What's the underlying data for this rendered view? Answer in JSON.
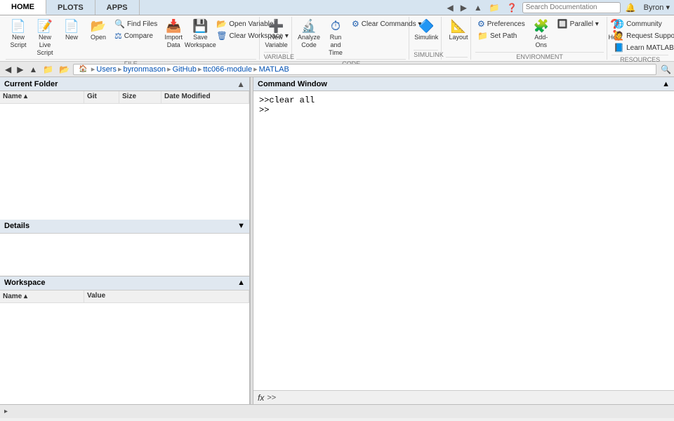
{
  "tabs": [
    {
      "label": "HOME",
      "active": true
    },
    {
      "label": "PLOTS",
      "active": false
    },
    {
      "label": "APPS",
      "active": false
    }
  ],
  "search": {
    "placeholder": "Search Documentation"
  },
  "user": {
    "label": "Byron ▾"
  },
  "ribbon": {
    "sections": [
      {
        "label": "FILE",
        "items": [
          {
            "type": "big",
            "icon": "📄",
            "label": "New\nScript"
          },
          {
            "type": "big",
            "icon": "📝",
            "label": "New\nLive Script"
          },
          {
            "type": "big",
            "icon": "📄",
            "label": "New"
          },
          {
            "type": "big",
            "icon": "📂",
            "label": "Open"
          },
          {
            "type": "small-group",
            "items": [
              {
                "icon": "🔍",
                "label": "Find Files"
              },
              {
                "icon": "⚖",
                "label": "Compare"
              }
            ]
          },
          {
            "type": "big",
            "icon": "📥",
            "label": "Import\nData"
          },
          {
            "type": "big",
            "icon": "💾",
            "label": "Save\nWorkspace"
          },
          {
            "type": "small-group",
            "items": [
              {
                "icon": "📂",
                "label": "Open Variable"
              },
              {
                "icon": "🗑",
                "label": "Clear Workspace ▾"
              }
            ]
          }
        ]
      },
      {
        "label": "VARIABLE",
        "items": [
          {
            "type": "big",
            "icon": "➕",
            "label": "New\nVariable"
          }
        ]
      },
      {
        "label": "CODE",
        "items": [
          {
            "type": "big",
            "icon": "▶",
            "label": "Analyze\nCode"
          },
          {
            "type": "big",
            "icon": "▶▶",
            "label": "Run and\nTime"
          },
          {
            "type": "small-group",
            "items": [
              {
                "icon": "⚙",
                "label": "Clear Commands ▾"
              }
            ]
          }
        ]
      },
      {
        "label": "SIMULINK",
        "items": [
          {
            "type": "big",
            "icon": "🔷",
            "label": "Simulink"
          }
        ]
      },
      {
        "label": "",
        "items": [
          {
            "type": "big",
            "icon": "📐",
            "label": "Layout"
          }
        ]
      },
      {
        "label": "ENVIRONMENT",
        "items": [
          {
            "type": "small-group",
            "items": [
              {
                "icon": "⚙",
                "label": "Preferences"
              },
              {
                "icon": "📁",
                "label": "Set Path"
              }
            ]
          },
          {
            "type": "big",
            "icon": "🧩",
            "label": "Add-Ons"
          },
          {
            "type": "small-group",
            "items": [
              {
                "icon": "🔲",
                "label": "Parallel ▾"
              }
            ]
          },
          {
            "type": "big",
            "icon": "❓",
            "label": "Help"
          }
        ]
      },
      {
        "label": "RESOURCES",
        "items": [
          {
            "type": "small-group",
            "items": [
              {
                "icon": "🌐",
                "label": "Community"
              },
              {
                "icon": "🙋",
                "label": "Request Support"
              },
              {
                "icon": "📘",
                "label": "Learn MATLAB"
              }
            ]
          }
        ]
      }
    ]
  },
  "nav": {
    "path": [
      "Users",
      "byronmason",
      "GitHub",
      "ttc066-module",
      "MATLAB"
    ]
  },
  "left_panel": {
    "title": "Current Folder",
    "columns": [
      "Name ▴",
      "Git",
      "Size",
      "Date Modified"
    ]
  },
  "details": {
    "title": "Details"
  },
  "workspace": {
    "title": "Workspace",
    "columns": [
      "Name ▴",
      "Value"
    ]
  },
  "command_window": {
    "title": "Command Window",
    "lines": [
      {
        "prompt": ">>",
        "code": " clear all"
      },
      {
        "prompt": ">>",
        "code": ""
      }
    ],
    "fx_label": "fx"
  },
  "status_bar": {
    "text": "▸"
  }
}
